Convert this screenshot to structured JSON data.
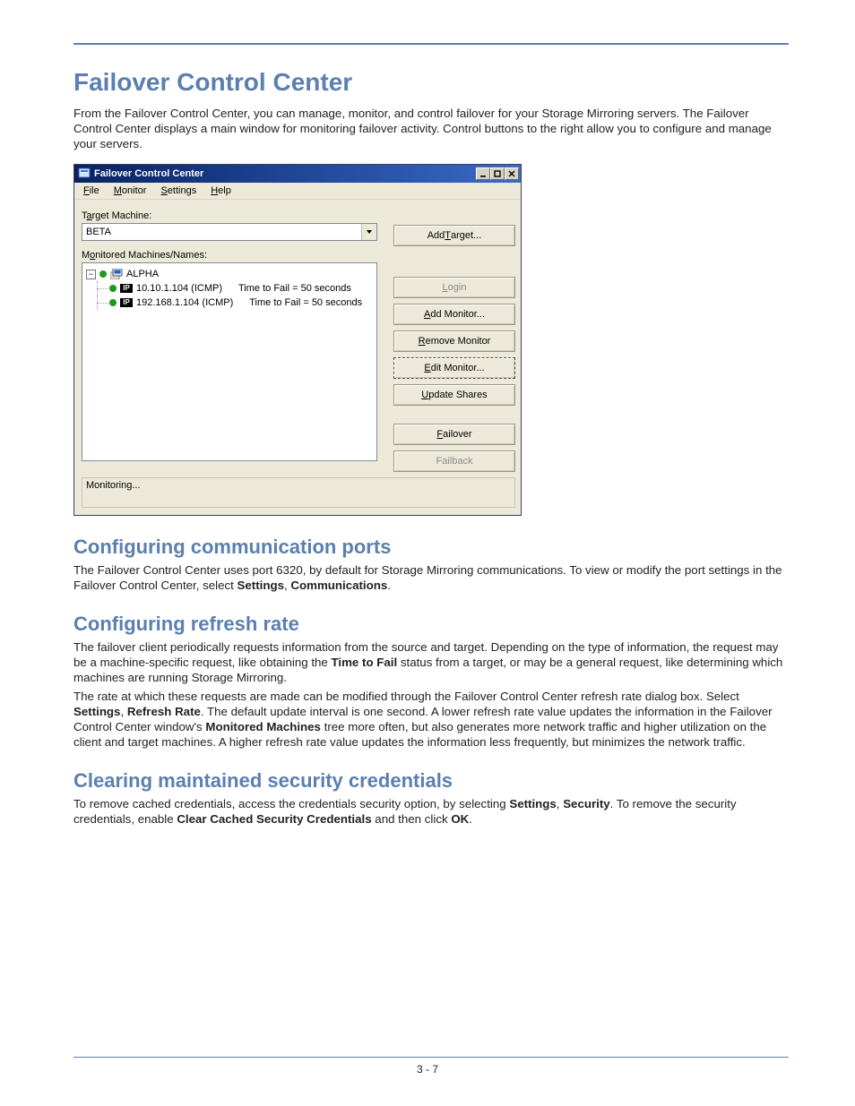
{
  "page": {
    "title": "Failover Control Center",
    "intro": "From the Failover Control Center, you can manage, monitor, and control failover for your Storage Mirroring servers. The Failover Control Center displays a main window for monitoring failover activity. Control buttons to the right allow you to configure and manage your servers.",
    "footer": "3 - 7"
  },
  "app": {
    "title": "Failover Control Center",
    "menu": {
      "file_pre": "",
      "file_u": "F",
      "file_post": "ile",
      "monitor_pre": "",
      "monitor_u": "M",
      "monitor_post": "onitor",
      "settings_pre": "",
      "settings_u": "S",
      "settings_post": "ettings",
      "help_pre": "",
      "help_u": "H",
      "help_post": "elp"
    },
    "labels": {
      "target_pre": "T",
      "target_u": "a",
      "target_post": "rget Machine:",
      "monitored_pre": "M",
      "monitored_u": "o",
      "monitored_post": "nitored Machines/Names:"
    },
    "target_value": "BETA",
    "tree": {
      "root_name": "ALPHA",
      "rows": [
        {
          "ip": "10.10.1.104 (ICMP)",
          "time": "Time to Fail = 50 seconds"
        },
        {
          "ip": "192.168.1.104 (ICMP)",
          "time": "Time to Fail = 50 seconds"
        }
      ],
      "ip_icon_text": "IP",
      "expander": "−"
    },
    "buttons": {
      "add_target_pre": "Add ",
      "add_target_u": "T",
      "add_target_post": "arget...",
      "login_pre": "",
      "login_u": "L",
      "login_post": "ogin",
      "add_monitor_pre": "",
      "add_monitor_u": "A",
      "add_monitor_post": "dd Monitor...",
      "remove_monitor_pre": "",
      "remove_monitor_u": "R",
      "remove_monitor_post": "emove Monitor",
      "edit_monitor_pre": "",
      "edit_monitor_u": "E",
      "edit_monitor_post": "dit Monitor...",
      "update_shares_pre": "",
      "update_shares_u": "U",
      "update_shares_post": "pdate Shares",
      "failover_pre": "",
      "failover_u": "F",
      "failover_post": "ailover",
      "failback_label": "Failback"
    },
    "status": "Monitoring..."
  },
  "sections": {
    "comm": {
      "heading": "Configuring communication ports",
      "p1_a": "The Failover Control Center uses port 6320, by default for Storage Mirroring communications. To view or modify the port settings in the Failover Control Center, select ",
      "p1_b": "Settings",
      "p1_c": ", ",
      "p1_d": "Communications",
      "p1_e": "."
    },
    "refresh": {
      "heading": "Configuring refresh rate",
      "p1_a": "The failover client periodically requests information from the source and target. Depending on the type of information, the request may be a machine-specific request, like obtaining the ",
      "p1_b": "Time to Fail",
      "p1_c": " status from a target, or may be a general request, like determining which machines are running Storage Mirroring.",
      "p2_a": "The rate at which these requests are made can be modified through the Failover Control Center refresh rate dialog box. Select ",
      "p2_b": "Settings",
      "p2_c": ", ",
      "p2_d": "Refresh Rate",
      "p2_e": ". The default update interval is one second. A lower refresh rate value updates the information in the Failover Control Center window's ",
      "p2_f": "Monitored Machines",
      "p2_g": " tree more often, but also generates more network traffic and higher utilization on the client and target machines. A higher refresh rate value updates the information less frequently, but minimizes the network traffic."
    },
    "security": {
      "heading": "Clearing maintained security credentials",
      "p1_a": "To remove cached credentials, access the credentials security option, by selecting ",
      "p1_b": "Settings",
      "p1_c": ", ",
      "p1_d": "Security",
      "p1_e": ".  To remove the security credentials, enable ",
      "p1_f": "Clear Cached Security Credentials",
      "p1_g": " and then click ",
      "p1_h": "OK",
      "p1_i": "."
    }
  }
}
